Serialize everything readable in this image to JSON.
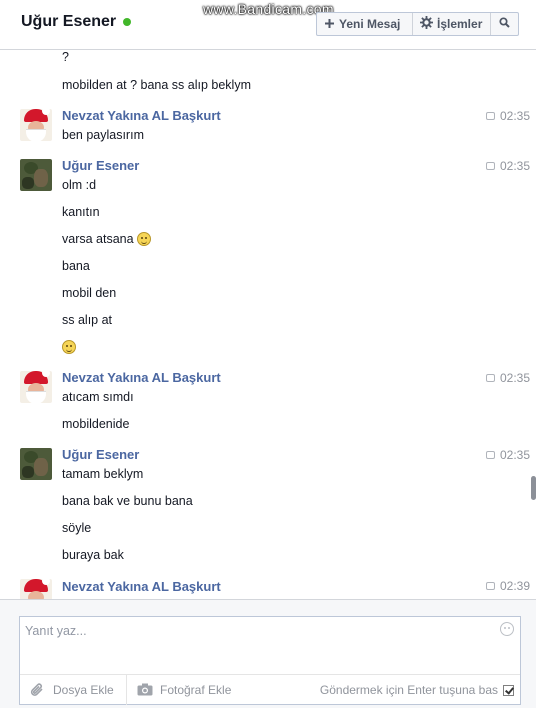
{
  "header": {
    "contact_name": "Uğur Esener",
    "watermark": "www.Bandicam.com",
    "new_message_label": "Yeni Mesaj",
    "actions_label": "İşlemler",
    "online_color": "#42b72a"
  },
  "thread": {
    "m0": "?",
    "m1": "mobilden at ? bana ss alıp beklym",
    "g1": {
      "sender": "Nevzat Yakına AL Başkurt",
      "time": "02:35",
      "m1": "ben paylasırım"
    },
    "g2": {
      "sender": "Uğur Esener",
      "time": "02:35",
      "m1": "olm :d",
      "m2": "kanıtın",
      "m3": "varsa atsana",
      "m4": "bana",
      "m5": "mobil den",
      "m6": "ss alıp at"
    },
    "g3": {
      "sender": "Nevzat Yakına AL Başkurt",
      "time": "02:35",
      "m1": "atıcam sımdı",
      "m2": "mobildenide"
    },
    "g4": {
      "sender": "Uğur Esener",
      "time": "02:35",
      "m1": "tamam beklym",
      "m2": "bana bak ve bunu bana",
      "m3": "söyle",
      "m4": "buraya bak"
    },
    "g5": {
      "sender": "Nevzat Yakına AL Başkurt",
      "time": "02:39"
    }
  },
  "composer": {
    "placeholder": "Yanıt yaz...",
    "file_label": "Dosya Ekle",
    "photo_label": "Fotoğraf Ekle",
    "send_hint": "Göndermek için Enter tuşuna bas",
    "enter_to_send_checked": true
  },
  "icons": {
    "new_message": "plus-icon",
    "actions": "gear-icon",
    "search": "search-icon",
    "file": "paperclip-icon",
    "photo": "camera-icon",
    "emoji": "smiley-icon"
  }
}
